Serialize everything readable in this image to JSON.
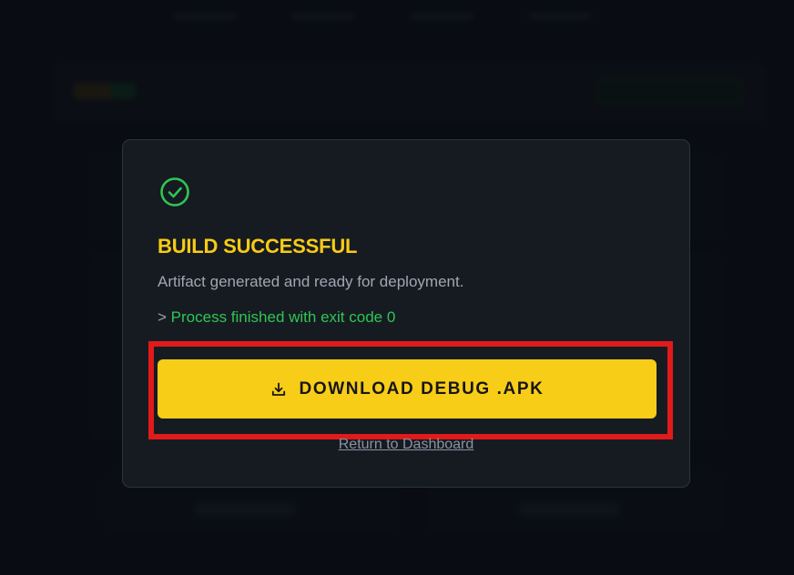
{
  "modal": {
    "icon": "check-circle-icon",
    "title": "BUILD SUCCESSFUL",
    "subtitle": "Artifact generated and ready for deployment.",
    "console_prompt": ">",
    "console_text": "Process finished with exit code 0",
    "download_button": {
      "icon": "download-icon",
      "label": "DOWNLOAD DEBUG .APK"
    },
    "return_link": "Return to Dashboard"
  },
  "colors": {
    "accent_yellow": "#f8cd18",
    "success_green": "#2fc653",
    "highlight_red": "#e11a1a",
    "modal_bg": "#161b22",
    "page_bg": "#0c0f16"
  }
}
